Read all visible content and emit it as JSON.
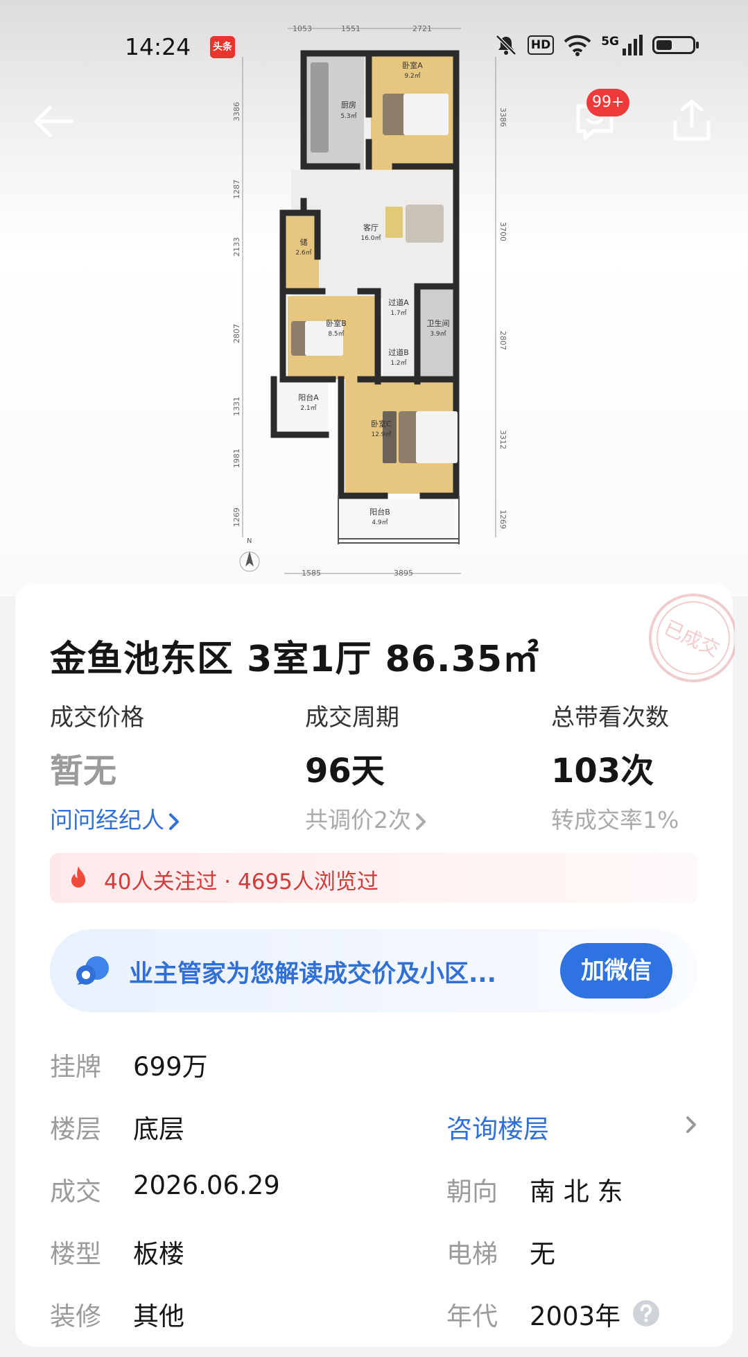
{
  "status_bar": {
    "time": "14:24",
    "app_badge": "头条",
    "hd": "HD",
    "net": "5G"
  },
  "header": {
    "message_badge": "99+"
  },
  "floorplan": {
    "top_dims": [
      "1053",
      "1551",
      "2721"
    ],
    "bottom_dims": [
      "1585",
      "3895"
    ],
    "left_dims": [
      "3386",
      "1287",
      "2133",
      "2807",
      "1331",
      "1981",
      "1269"
    ],
    "right_dims": [
      "3386",
      "3700",
      "2807",
      "3312",
      "1269"
    ],
    "north": "N",
    "rooms": [
      {
        "name": "厨房",
        "area": "5.3㎡"
      },
      {
        "name": "卧室A",
        "area": "9.2㎡"
      },
      {
        "name": "客厅",
        "area": "16.0㎡"
      },
      {
        "name": "储",
        "area": "2.6㎡"
      },
      {
        "name": "过道A",
        "area": "1.7㎡"
      },
      {
        "name": "卫生间",
        "area": "3.9㎡"
      },
      {
        "name": "卧室B",
        "area": "8.5㎡"
      },
      {
        "name": "过道B",
        "area": "1.2㎡"
      },
      {
        "name": "阳台A",
        "area": "2.1㎡"
      },
      {
        "name": "卧室C",
        "area": "12.9㎡"
      },
      {
        "name": "阳台B",
        "area": "4.9㎡"
      }
    ]
  },
  "listing": {
    "title": "金鱼池东区 3室1厅 86.35㎡",
    "stamp": "已成交",
    "stats": [
      {
        "label": "成交价格",
        "value": "暂无",
        "sub": "问问经纪人"
      },
      {
        "label": "成交周期",
        "value": "96天",
        "sub": "共调价2次"
      },
      {
        "label": "总带看次数",
        "value": "103次",
        "sub": "转成交率1%"
      }
    ],
    "hot_text": "40人关注过 · 4695人浏览过",
    "advisor_text": "业主管家为您解读成交价及小区...",
    "advisor_button": "加微信",
    "info": {
      "listing_price": {
        "k": "挂牌",
        "v": "699万"
      },
      "floor": {
        "k": "楼层",
        "v": "底层"
      },
      "floor_link": "咨询楼层",
      "deal_date": {
        "k": "成交",
        "v": "2026.06.29"
      },
      "orientation": {
        "k": "朝向",
        "v": "南 北 东"
      },
      "building_type": {
        "k": "楼型",
        "v": "板楼"
      },
      "elevator": {
        "k": "电梯",
        "v": "无"
      },
      "decoration": {
        "k": "装修",
        "v": "其他"
      },
      "year": {
        "k": "年代",
        "v": "2003年"
      }
    }
  },
  "colors": {
    "accent_blue": "#2f6fd6",
    "hot_red": "#d33a3a",
    "room_yellow": "#e7c67f",
    "wall": "#2b2b2b"
  }
}
